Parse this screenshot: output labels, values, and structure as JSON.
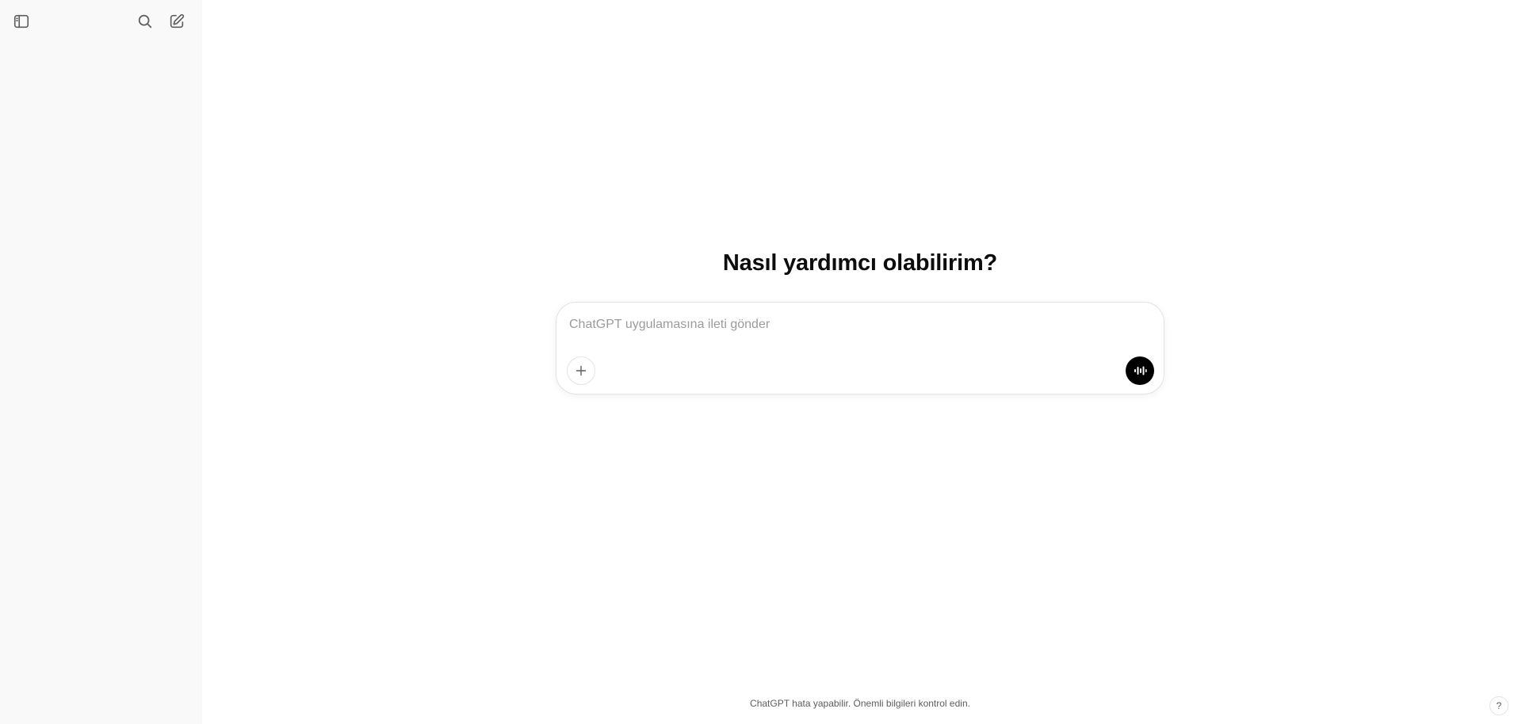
{
  "sidebar": {
    "icons": {
      "toggle": "sidebar-toggle-icon",
      "search": "search-icon",
      "new_chat": "new-chat-icon"
    }
  },
  "main": {
    "heading": "Nasıl yardımcı olabilirim?",
    "composer": {
      "placeholder": "ChatGPT uygulamasına ileti gönder",
      "value": "",
      "plus_icon": "plus-icon",
      "voice_icon": "voice-mode-icon"
    },
    "footer": {
      "disclaimer": "ChatGPT hata yapabilir. Önemli bilgileri kontrol edin.",
      "help_label": "?"
    }
  },
  "colors": {
    "sidebar_bg": "#f9f9f9",
    "main_bg": "#ffffff",
    "voice_button_bg": "#000000",
    "text": "#0d0d0d",
    "placeholder": "#9b9b9b"
  }
}
